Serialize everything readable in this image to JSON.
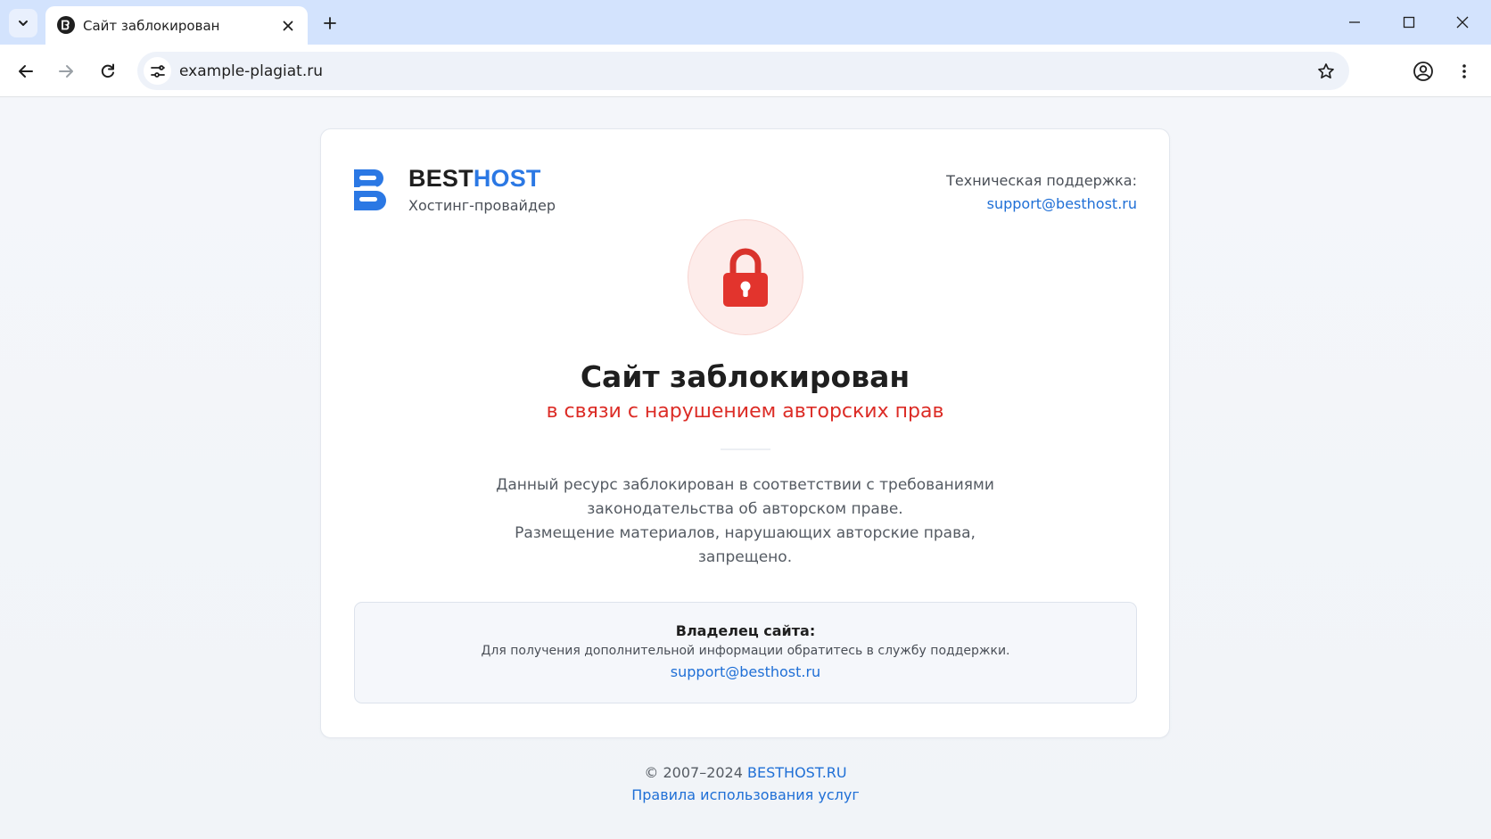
{
  "browser": {
    "tab": {
      "title": "Сайт заблокирован"
    },
    "address_bar": {
      "url": "example-plagiat.ru"
    }
  },
  "brand": {
    "name_part1": "BEST",
    "name_part2": "HOST",
    "tagline": "Хостинг-провайдер",
    "accent_color": "#2b78e4"
  },
  "support": {
    "label": "Техническая поддержка:",
    "email": "support@besthost.ru"
  },
  "status": {
    "title": "Сайт заблокирован",
    "reason": "в связи с нарушением авторских прав",
    "reason_color": "#dc2c26",
    "icon": "lock-icon"
  },
  "description": {
    "lines": [
      "Данный ресурс заблокирован в соответствии с требованиями",
      "законодательства об авторском праве.",
      "Размещение материалов, нарушающих авторские права,",
      "запрещено."
    ]
  },
  "owner_notice": {
    "title": "Владелец сайта:",
    "text": "Для получения дополнительной информации обратитесь в службу поддержки.",
    "email": "support@besthost.ru"
  },
  "footer": {
    "copyright": "© 2007–2024",
    "site_link": "BESTHOST.RU",
    "terms_link": "Правила использования услуг"
  }
}
